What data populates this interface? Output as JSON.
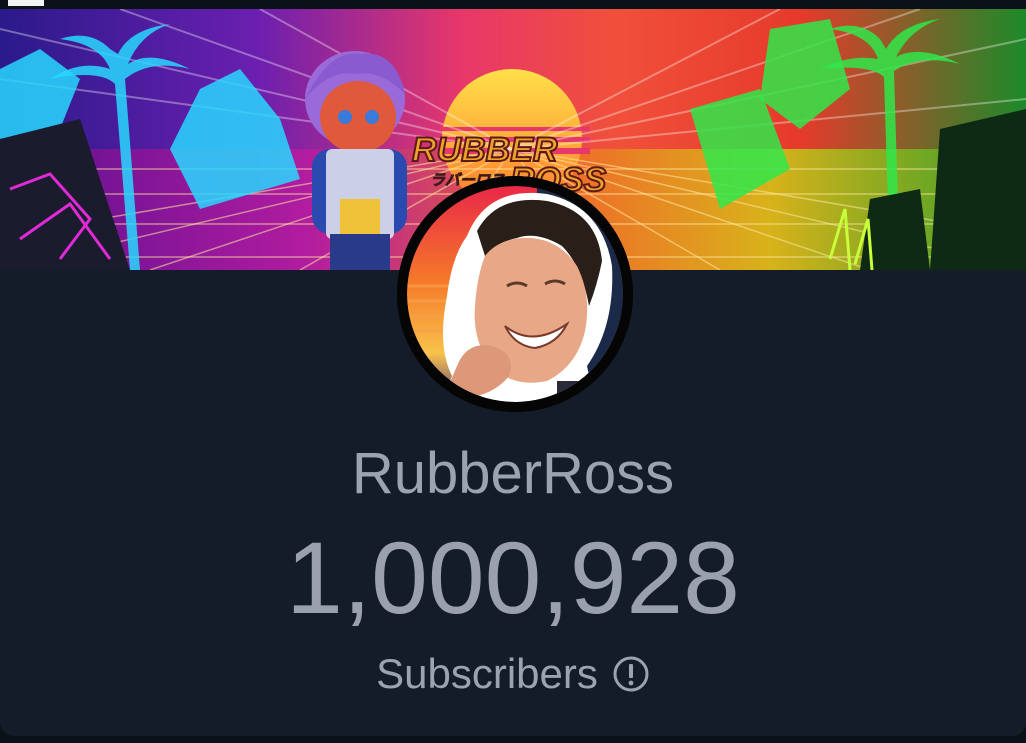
{
  "channel": {
    "name": "RubberRoss",
    "subscriber_count": "1,000,928",
    "subscriber_label": "Subscribers",
    "info_icon": "info-circle-icon"
  },
  "banner": {
    "logo_line1": "RUBBER",
    "logo_line2": "ROSS",
    "logo_japanese": "ラバーロス"
  },
  "colors": {
    "background": "#131c28",
    "text": "#9ba3b0",
    "banner_sun": "#ffb347",
    "banner_cyan": "#28d8ff",
    "banner_green": "#2fe84a",
    "banner_magenta": "#e02ad6"
  }
}
